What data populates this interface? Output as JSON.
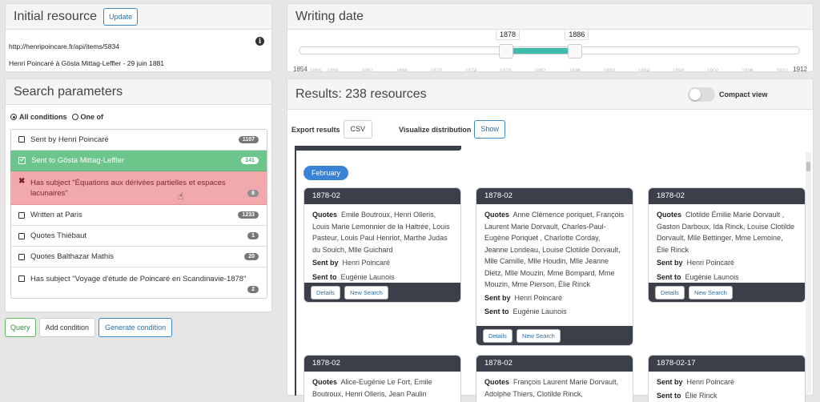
{
  "initial_resource": {
    "title": "Initial resource",
    "update_label": "Update",
    "url": "http://henripoincare.fr/api/items/5834",
    "description": "Henri Poincaré à Gösta Mittag-Leffler - 29 juin 1881",
    "info_icon": "info-icon"
  },
  "search_parameters": {
    "title": "Search parameters",
    "all_conditions_label": "All conditions",
    "one_of_label": "One of",
    "conditions": [
      {
        "label": "Sent by Henri Poincaré",
        "count": "1107",
        "state": "unchecked"
      },
      {
        "label": "Sent to Gösta Mittag-Leffler",
        "count": "141",
        "state": "checked"
      },
      {
        "label": "Has subject \"Équations aux dérivées partielles et espaces lacunaires\"",
        "count": "8",
        "state": "excluded"
      },
      {
        "label": "Written at Paris",
        "count": "1233",
        "state": "unchecked"
      },
      {
        "label": "Quotes Thiébaut",
        "count": "1",
        "state": "unchecked"
      },
      {
        "label": "Quotes Balthazar Mathis",
        "count": "20",
        "state": "unchecked"
      },
      {
        "label": "Has subject \"Voyage d'étude de Poincaré en Scandinavie-1878\"",
        "count": "2",
        "state": "unchecked"
      }
    ],
    "query_label": "Query",
    "add_condition_label": "Add condition",
    "generate_condition_label": "Generate condition"
  },
  "writing_date": {
    "title": "Writing date",
    "min": 1854,
    "max": 1912,
    "low": 1878,
    "high": 1886,
    "low_label": "1878",
    "high_label": "1886",
    "min_label": "1854",
    "max_label": "1912",
    "accent": "#3dbcae",
    "ticks": [
      "1856",
      "1858",
      "1862",
      "1866",
      "1870",
      "1874",
      "1878",
      "1882",
      "1886",
      "1890",
      "1894",
      "1898",
      "1902",
      "1906",
      "1910"
    ]
  },
  "results": {
    "title": "Results: 238 resources",
    "compact_view_label": "Compact view",
    "export_label": "Export results",
    "csv_label": "CSV",
    "visualize_label": "Visualize distribution",
    "show_label": "Show",
    "month_label": "February",
    "details_label": "Details",
    "new_search_label": "New Search",
    "quotes_key": "Quotes",
    "sent_by_key": "Sent by",
    "sent_to_key": "Sent to",
    "cards": [
      {
        "date": "1878-02",
        "quotes": "Emile Boutroux, Henri Olleris, Louis Marie Lemonnier de la Haitrée, Louis Pasteur, Louis Paul Henriot, Marthe Judas du Souich, Mlle Guichard",
        "sent_by": "Henri Poincaré",
        "sent_to": "Eugénie Launois"
      },
      {
        "date": "1878-02",
        "quotes": "Anne Clémence poriquet, François Laurent Marie Dorvault, Charles-Paul-Eugène Poriquet , Charlotte Corday, Jeanne Londeau, Louise Clotilde Dorvault, Mlle Camille, Mlle Houdin, Mlle Jeanne Dietz, Mlle Mouzin, Mme Bompard, Mme Mouzin, Mme Pierson, Élie Rinck",
        "sent_by": "Henri Poincaré",
        "sent_to": "Eugénie Launois"
      },
      {
        "date": "1878-02",
        "quotes": "Clotilde Émilie Marie Dorvault , Gaston Darboux, Ida Rinck, Louise Clotilde Dorvault, Mlle Bettinger, Mme Lemoine, Élie Rinck",
        "sent_by": "Henri Poincaré",
        "sent_to": "Eugénie Launois"
      },
      {
        "date": "1878-02",
        "quotes": "Alice-Eugénie Le Fort, Emile Boutroux, Henri Olleris, Jean Paulin"
      },
      {
        "date": "1878-02",
        "quotes": "François Laurent Marie Dorvault, Adolphe Thiers, Clotilde Rinck,"
      },
      {
        "date": "1878-02-17",
        "sent_by": "Henri Poincaré",
        "sent_to": "Élie Rinck"
      }
    ]
  }
}
